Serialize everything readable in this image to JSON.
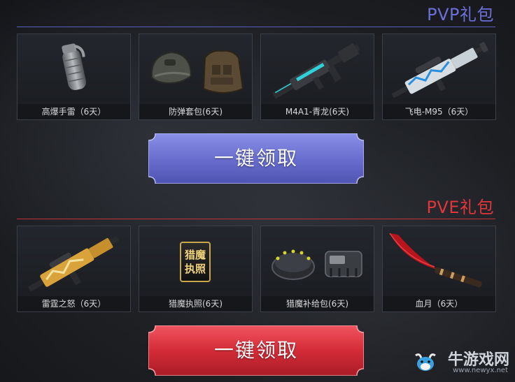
{
  "pvp": {
    "title": "PVP礼包",
    "color": "#6b70d8",
    "items": [
      {
        "label": "高爆手雷（6天）",
        "icon": "grenade-icon"
      },
      {
        "label": "防弹套包(6天)",
        "icon": "helmet-vest-icon"
      },
      {
        "label": "M4A1-青龙(6天)",
        "icon": "rifle-icon"
      },
      {
        "label": "飞电-M95（6天）",
        "icon": "sniper-rifle-icon"
      }
    ],
    "claim_label": "一键领取"
  },
  "pve": {
    "title": "PVE礼包",
    "color": "#e0363c",
    "items": [
      {
        "label": "雷霆之怒（6天）",
        "icon": "gold-rifle-icon"
      },
      {
        "label": "猎魔执照(6天)",
        "icon": "license-badge-icon",
        "badge_text": "猎魔执照"
      },
      {
        "label": "猎魔补给包(6天)",
        "icon": "supply-pack-icon"
      },
      {
        "label": "血月（6天）",
        "icon": "blood-moon-scythe-icon"
      }
    ],
    "claim_label": "一键领取"
  },
  "watermark": {
    "name": "牛游戏网",
    "url": "www.newyx.net"
  }
}
